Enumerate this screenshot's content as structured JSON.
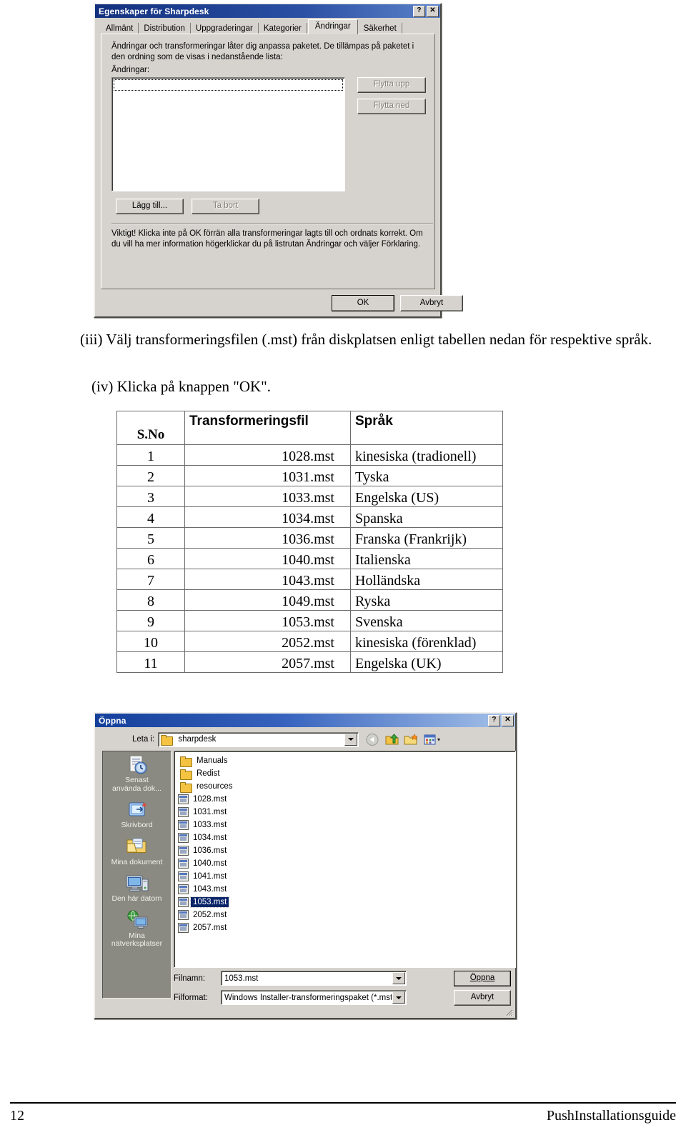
{
  "properties_dialog": {
    "title": "Egenskaper för Sharpdesk",
    "help_button": "?",
    "close_button": "✕",
    "tabs": [
      {
        "label": "Allmänt",
        "active": false
      },
      {
        "label": "Distribution",
        "active": false
      },
      {
        "label": "Uppgraderingar",
        "active": false
      },
      {
        "label": "Kategorier",
        "active": false
      },
      {
        "label": "Ändringar",
        "active": true
      },
      {
        "label": "Säkerhet",
        "active": false
      }
    ],
    "description": "Ändringar och transformeringar låter dig anpassa paketet. De tillämpas på paketet i den ordning som de visas i nedanstående lista:",
    "list_label": "Ändringar:",
    "list_items": [],
    "move_up_button": "Flytta upp",
    "move_down_button": "Flytta ned",
    "add_button": "Lägg till...",
    "remove_button": "Ta bort",
    "warning": "Viktigt! Klicka inte på OK förrän alla transformeringar lagts till och ordnats korrekt. Om du vill ha mer information högerklickar du på listrutan Ändringar och väljer Förklaring.",
    "ok_button": "OK",
    "cancel_button": "Avbryt"
  },
  "instructions": {
    "step_iii": "(iii) Välj transformeringsfilen (.mst) från diskplatsen enligt tabellen nedan för respektive språk.",
    "step_iv": "(iv) Klicka på knappen \"OK\"."
  },
  "language_table": {
    "headers": [
      "S.No",
      "Transformeringsfil",
      "Språk"
    ],
    "rows": [
      [
        "1",
        "1028.mst",
        "kinesiska (tradionell)"
      ],
      [
        "2",
        "1031.mst",
        "Tyska"
      ],
      [
        "3",
        "1033.mst",
        "Engelska (US)"
      ],
      [
        "4",
        "1034.mst",
        "Spanska"
      ],
      [
        "5",
        "1036.mst",
        "Franska (Frankrijk)"
      ],
      [
        "6",
        "1040.mst",
        "Italienska"
      ],
      [
        "7",
        "1043.mst",
        "Holländska"
      ],
      [
        "8",
        "1049.mst",
        "Ryska"
      ],
      [
        "9",
        "1053.mst",
        "Svenska"
      ],
      [
        "10",
        "2052.mst",
        "kinesiska (förenklad)"
      ],
      [
        "11",
        "2057.mst",
        "Engelska (UK)"
      ]
    ]
  },
  "open_dialog": {
    "title": "Öppna",
    "help_button": "?",
    "close_button": "✕",
    "lookin_label": "Leta i:",
    "lookin_value": "sharpdesk",
    "toolbar_icons": [
      "back-icon",
      "up-folder-icon",
      "new-folder-icon",
      "views-icon"
    ],
    "places": [
      {
        "label": "Senast\nanvända dok...",
        "icon": "recent-documents-icon"
      },
      {
        "label": "Skrivbord",
        "icon": "desktop-icon"
      },
      {
        "label": "Mina dokument",
        "icon": "my-documents-icon"
      },
      {
        "label": "Den här datorn",
        "icon": "my-computer-icon"
      },
      {
        "label": "Mina\nnätverksplatser",
        "icon": "network-places-icon"
      }
    ],
    "files": [
      {
        "name": "Manuals",
        "type": "folder",
        "selected": false
      },
      {
        "name": "Redist",
        "type": "folder",
        "selected": false
      },
      {
        "name": "resources",
        "type": "folder",
        "selected": false
      },
      {
        "name": "1028.mst",
        "type": "mst",
        "selected": false
      },
      {
        "name": "1031.mst",
        "type": "mst",
        "selected": false
      },
      {
        "name": "1033.mst",
        "type": "mst",
        "selected": false
      },
      {
        "name": "1034.mst",
        "type": "mst",
        "selected": false
      },
      {
        "name": "1036.mst",
        "type": "mst",
        "selected": false
      },
      {
        "name": "1040.mst",
        "type": "mst",
        "selected": false
      },
      {
        "name": "1041.mst",
        "type": "mst",
        "selected": false
      },
      {
        "name": "1043.mst",
        "type": "mst",
        "selected": false
      },
      {
        "name": "1053.mst",
        "type": "mst",
        "selected": true
      },
      {
        "name": "2052.mst",
        "type": "mst",
        "selected": false
      },
      {
        "name": "2057.mst",
        "type": "mst",
        "selected": false
      }
    ],
    "filename_label": "Filnamn:",
    "filename_value": "1053.mst",
    "filetype_label": "Filformat:",
    "filetype_value": "Windows Installer-transformeringspaket (*.mst)",
    "open_button": "Öppna",
    "cancel_button": "Avbryt"
  },
  "footer": {
    "page_number": "12",
    "document_title": "PushInstallationsguide"
  }
}
